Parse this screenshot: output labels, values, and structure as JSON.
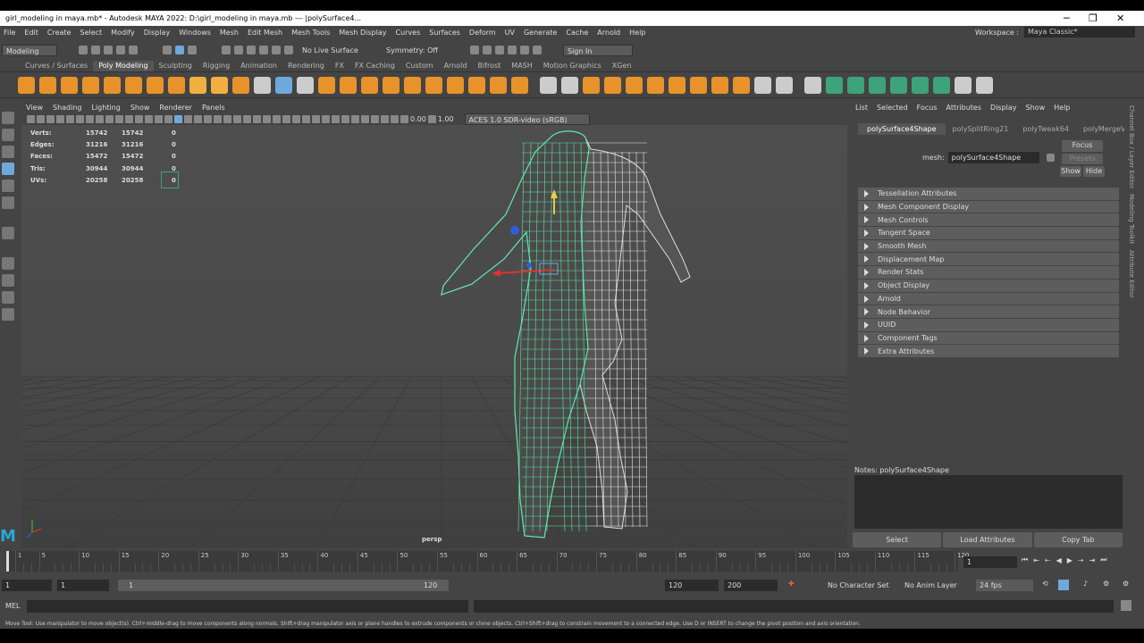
{
  "window": {
    "title": "girl_modeling in maya.mb* - Autodesk MAYA 2022: D:\\girl_modeling in maya.mb  ---  |polySurface4...",
    "min": "─",
    "max": "❐",
    "close": "✕"
  },
  "menu": [
    "File",
    "Edit",
    "Create",
    "Select",
    "Modify",
    "Display",
    "Windows",
    "Mesh",
    "Edit Mesh",
    "Mesh Tools",
    "Mesh Display",
    "Curves",
    "Surfaces",
    "Deform",
    "UV",
    "Generate",
    "Cache",
    "Arnold",
    "Help"
  ],
  "workspace": {
    "label": "Workspace :",
    "value": "Maya Classic*"
  },
  "status": {
    "mode": "Modeling",
    "live": "No Live Surface",
    "symmetry": "Symmetry: Off",
    "signin": "Sign In"
  },
  "shelf_tabs": [
    "Curves / Surfaces",
    "Poly Modeling",
    "Sculpting",
    "Rigging",
    "Animation",
    "Rendering",
    "FX",
    "FX Caching",
    "Custom",
    "Arnold",
    "Bifrost",
    "MASH",
    "Motion Graphics",
    "XGen"
  ],
  "shelf_icon_colors": [
    "#e8922a",
    "#e8922a",
    "#e8922a",
    "#e8922a",
    "#e8922a",
    "#e8922a",
    "#e8922a",
    "#e8922a",
    "#f0b040",
    "#f0b040",
    "#e8922a",
    "#ccc",
    "#6fa8dc",
    "#ccc",
    "#e8922a",
    "#e8922a",
    "#e8922a",
    "#e8922a",
    "#e8922a",
    "#e8922a",
    "#e8922a",
    "#e8922a",
    "#e8922a",
    "#e8922a",
    "#ccc",
    "#ccc",
    "#e8922a",
    "#e8922a",
    "#e8922a",
    "#e8922a",
    "#e8922a",
    "#e8922a",
    "#e8922a",
    "#e8922a",
    "#ccc",
    "#ccc",
    "#ccc",
    "#3ea37a",
    "#3ea37a",
    "#3ea37a",
    "#3ea37a",
    "#3ea37a",
    "#3ea37a",
    "#ccc",
    "#ccc"
  ],
  "viewport": {
    "menu": [
      "View",
      "Shading",
      "Lighting",
      "Show",
      "Renderer",
      "Panels"
    ],
    "exposure": "0.00",
    "gamma": "1.00",
    "colorspace": "ACES 1.0 SDR-video (sRGB)",
    "hud": [
      {
        "k": "Verts:",
        "a": "15742",
        "b": "15742",
        "c": "0"
      },
      {
        "k": "Edges:",
        "a": "31216",
        "b": "31216",
        "c": "0"
      },
      {
        "k": "Faces:",
        "a": "15472",
        "b": "15472",
        "c": "0"
      },
      {
        "k": "Tris:",
        "a": "30944",
        "b": "30944",
        "c": "0"
      },
      {
        "k": "UVs:",
        "a": "20258",
        "b": "20258",
        "c": "0"
      }
    ],
    "camera": "persp"
  },
  "attr": {
    "tabs": [
      "List",
      "Selected",
      "Focus",
      "Attributes",
      "Display",
      "Show",
      "Help"
    ],
    "nodetabs": [
      "polySurface4Shape",
      "polySplitRing21",
      "polyTweak64",
      "polyMergeVert..."
    ],
    "mesh_label": "mesh:",
    "mesh_value": "polySurface4Shape",
    "focus": "Focus",
    "presets": "Presets",
    "show": "Show",
    "hide": "Hide",
    "sections": [
      "Tessellation Attributes",
      "Mesh Component Display",
      "Mesh Controls",
      "Tangent Space",
      "Smooth Mesh",
      "Displacement Map",
      "Render Stats",
      "Object Display",
      "Arnold",
      "Node Behavior",
      "UUID",
      "Component Tags",
      "Extra Attributes"
    ],
    "notes": "Notes:  polySurface4Shape",
    "buttons": [
      "Select",
      "Load Attributes",
      "Copy Tab"
    ]
  },
  "side_tabs": [
    "Channel Box / Layer Editor",
    "Modeling Toolkit",
    "Attribute Editor"
  ],
  "timeline": {
    "ticks": [
      "1",
      "5",
      "10",
      "15",
      "20",
      "25",
      "30",
      "35",
      "40",
      "45",
      "50",
      "55",
      "60",
      "65",
      "70",
      "75",
      "80",
      "85",
      "90",
      "95",
      "100",
      "105",
      "110",
      "115",
      "120"
    ],
    "current": "1"
  },
  "range": {
    "start": "1",
    "start2": "1",
    "slider_start": "1",
    "slider_end": "120",
    "end": "120",
    "end2": "200",
    "char": "No Character Set",
    "layer": "No Anim Layer",
    "fps": "24 fps"
  },
  "mel": {
    "label": "MEL"
  },
  "help": "Move Tool: Use manipulator to move object(s). Ctrl+middle-drag to move components along normals. Shift+drag manipulator axis or plane handles to extrude components or clone objects. Ctrl+Shift+drag to constrain movement to a connected edge. Use D or INSERT to change the pivot position and axis orientation."
}
